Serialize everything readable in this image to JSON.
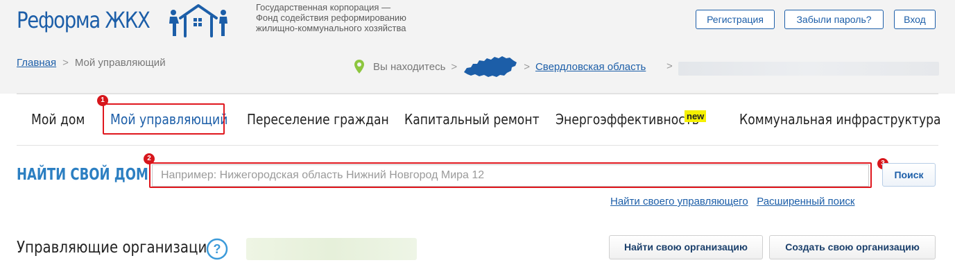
{
  "header": {
    "logo_text": "Реформа ЖКХ",
    "corp_lines": [
      "Государственная корпорация —",
      "Фонд содействия реформированию",
      "жилищно-коммунального хозяйства"
    ],
    "register_label": "Регистрация",
    "forgot_label": "Забыли пароль?",
    "login_label": "Вход"
  },
  "breadcrumb": {
    "home": "Главная",
    "separator": ">",
    "current": "Мой управляющий"
  },
  "location": {
    "prefix": "Вы находитесь",
    "separator": ">",
    "region": "Свердловская область",
    "icon": "map-pin-icon"
  },
  "nav": {
    "items": [
      {
        "label": "Мой дом"
      },
      {
        "label": "Мой управляющий",
        "active": true
      },
      {
        "label": "Переселение граждан"
      },
      {
        "label": "Капитальный ремонт"
      },
      {
        "label": "Энергоэффективность"
      },
      {
        "label": "Коммунальная инфраструктура"
      }
    ],
    "new_badge": "new"
  },
  "search": {
    "title": "НАЙТИ СВОЙ ДОМ",
    "placeholder": "Например: Нижегородская область Нижний Новгород Мира 12",
    "button_label": "Поиск",
    "link_find_manager": "Найти своего управляющего",
    "link_advanced": "Расширенный поиск"
  },
  "annotations": {
    "markers": [
      "1",
      "2",
      "3"
    ],
    "highlight_color": "#e0171e"
  },
  "orgs": {
    "title": "Управляющие организации",
    "help_icon": "?",
    "find_button": "Найти свою организацию",
    "create_button": "Создать свою организацию"
  },
  "colors": {
    "brand_blue": "#1c5ea8",
    "accent_blue": "#2c7fc2",
    "badge_yellow": "#f5f000",
    "header_bg": "#f3f3f3"
  }
}
